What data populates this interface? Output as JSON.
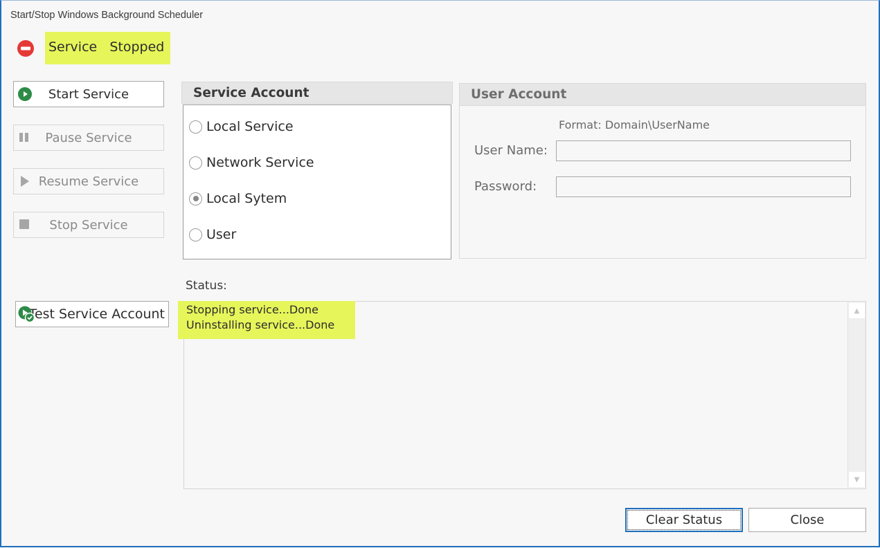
{
  "window": {
    "title": "Start/Stop Windows Background Scheduler"
  },
  "service_state": {
    "icon": "stop-circle-icon",
    "label": "Service   Stopped",
    "icon_color": "#e53935",
    "highlight_color": "#e6f55a"
  },
  "side_buttons": [
    {
      "label": "Start Service",
      "icon": "play-circle-icon",
      "enabled": true
    },
    {
      "label": "Pause Service",
      "icon": "pause-icon",
      "enabled": false
    },
    {
      "label": "Resume Service",
      "icon": "play-icon",
      "enabled": false
    },
    {
      "label": "Stop Service",
      "icon": "stop-square-icon",
      "enabled": false
    }
  ],
  "service_account": {
    "title": "Service Account",
    "options": [
      {
        "label": "Local Service",
        "selected": false
      },
      {
        "label": "Network Service",
        "selected": false
      },
      {
        "label": "Local Sytem",
        "selected": true
      },
      {
        "label": "User",
        "selected": false
      }
    ]
  },
  "user_account": {
    "title": "User Account",
    "format_hint": "Format: Domain\\UserName",
    "username_label": "User Name:",
    "username_value": "",
    "password_label": "Password:",
    "password_value": ""
  },
  "test_button": {
    "label": "Test Service Account",
    "icon": "play-check-icon"
  },
  "status": {
    "label": "Status:",
    "lines": [
      "Stopping service...Done",
      "Uninstalling service...Done"
    ]
  },
  "footer": {
    "clear_label": "Clear Status",
    "close_label": "Close"
  },
  "colors": {
    "accent_green": "#2e8b47",
    "focus_blue": "#1f6fbf"
  }
}
